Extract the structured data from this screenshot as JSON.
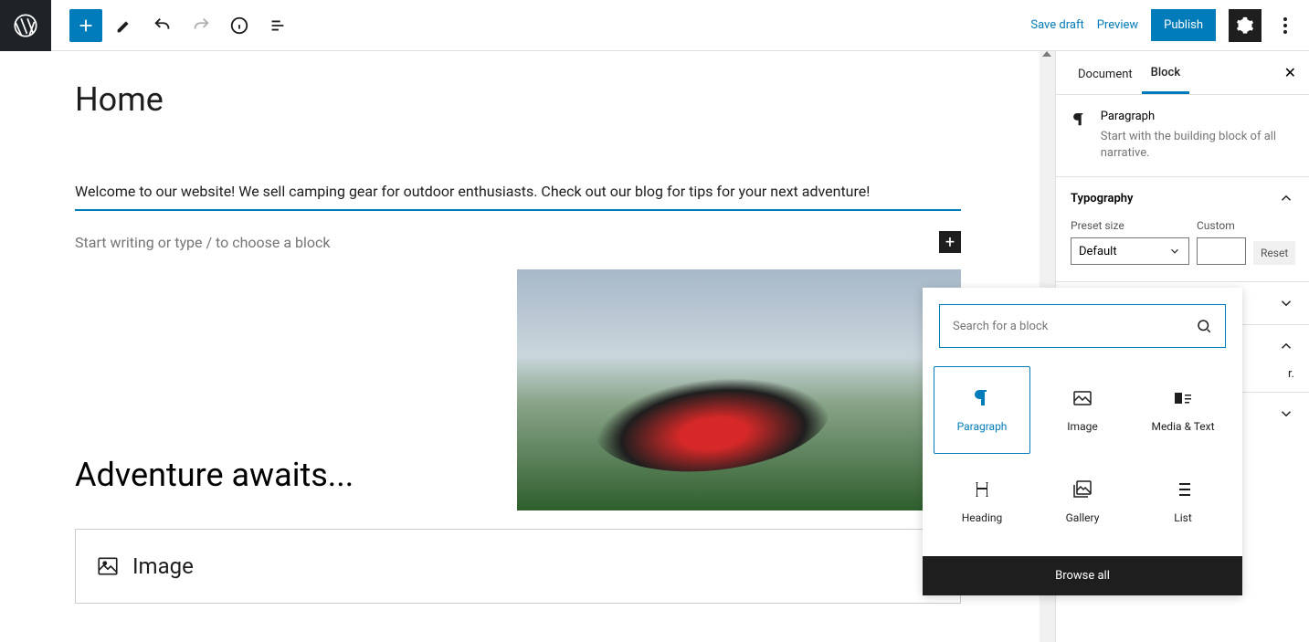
{
  "topbar": {
    "save_draft": "Save draft",
    "preview": "Preview",
    "publish": "Publish"
  },
  "page": {
    "title": "Home",
    "paragraph": "Welcome to our website! We sell camping gear for outdoor enthusiasts. Check out our blog for tips for your next adventure!",
    "placeholder": "Start writing or type / to choose a block",
    "heading": "Adventure awaits...",
    "image_block_label": "Image"
  },
  "sidebar": {
    "tabs": {
      "document": "Document",
      "block": "Block"
    },
    "block_info": {
      "title": "Paragraph",
      "desc": "Start with the building block of all narrative."
    },
    "typography": {
      "title": "Typography",
      "preset_label": "Preset size",
      "custom_label": "Custom",
      "preset_value": "Default",
      "reset": "Reset"
    },
    "truncated": "r."
  },
  "inserter": {
    "search_placeholder": "Search for a block",
    "items": [
      {
        "label": "Paragraph"
      },
      {
        "label": "Image"
      },
      {
        "label": "Media & Text"
      },
      {
        "label": "Heading"
      },
      {
        "label": "Gallery"
      },
      {
        "label": "List"
      }
    ],
    "browse_all": "Browse all"
  }
}
